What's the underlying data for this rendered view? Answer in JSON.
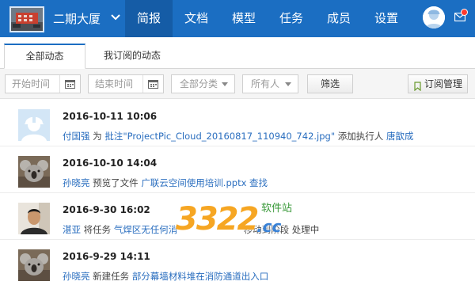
{
  "header": {
    "project_name": "二期大厦",
    "nav": [
      {
        "label": "简报",
        "active": true
      },
      {
        "label": "文档",
        "active": false
      },
      {
        "label": "模型",
        "active": false
      },
      {
        "label": "任务",
        "active": false
      },
      {
        "label": "成员",
        "active": false
      },
      {
        "label": "设置",
        "active": false
      }
    ],
    "accent_color": "#1b6ec2",
    "active_nav_color": "#155ca6",
    "icons": {
      "chevron": "chevron-down-icon",
      "avatar": "user-avatar",
      "mail": "mail-icon"
    }
  },
  "tabs": [
    {
      "label": "全部动态",
      "active": true
    },
    {
      "label": "我订阅的动态",
      "active": false
    }
  ],
  "filters": {
    "start_placeholder": "开始时间",
    "end_placeholder": "结束时间",
    "category": "全部分类",
    "owner": "所有人",
    "filter_button": "筛选",
    "subscribe_button": "订阅管理",
    "icons": {
      "calendar": "calendar-icon",
      "bookmark": "bookmark-icon"
    }
  },
  "feed": [
    {
      "time": "2016-10-11 10:06",
      "actor": "付国强",
      "parts": [
        "为",
        "批注",
        "\"ProjectPic_Cloud_20160817_110940_742.jpg\"",
        "添加执行人",
        "唐歆成"
      ],
      "avatar": "hardhat-avatar"
    },
    {
      "time": "2016-10-10 14:04",
      "actor": "孙晓亮",
      "parts": [
        "预览了文件",
        "广联云空间使用培训.pptx",
        "查找"
      ],
      "avatar": "koala-avatar"
    },
    {
      "time": "2016-9-30 16:02",
      "actor": "湛亚",
      "parts": [
        "将任务",
        "气焊区无任何消",
        "移动到阶段",
        "处理中"
      ],
      "avatar": "person-avatar"
    },
    {
      "time": "2016-9-29 14:11",
      "actor": "孙晓亮",
      "parts": [
        "新建任务",
        "部分幕墙材料堆在消防通道出入口"
      ],
      "avatar": "koala-avatar"
    }
  ],
  "watermark": {
    "number": "3322",
    "domain": ".cc",
    "site": "软件站"
  }
}
